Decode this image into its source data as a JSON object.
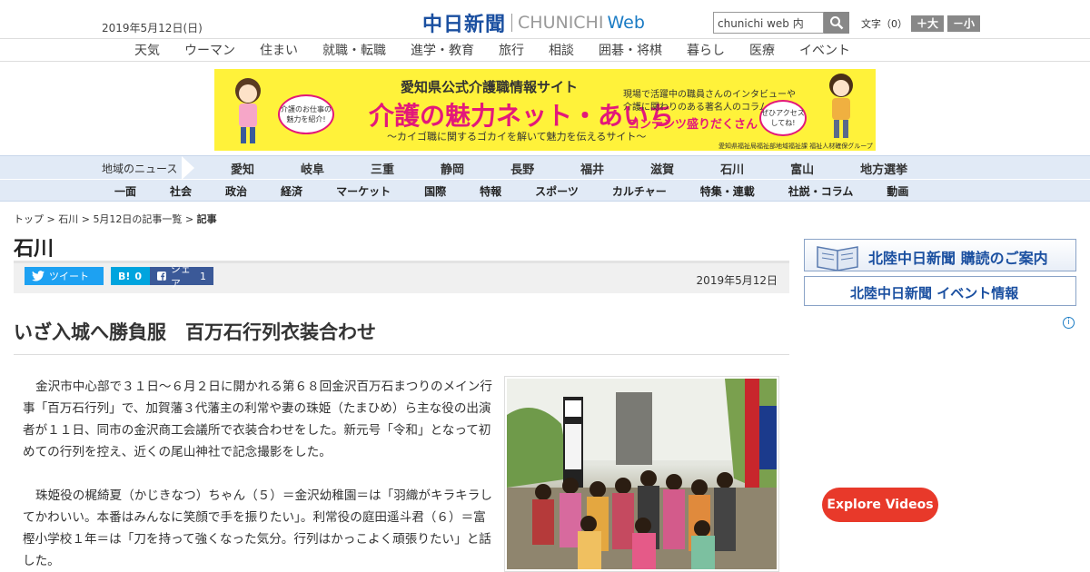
{
  "header": {
    "date": "2019年5月12日(日)",
    "logo_jp": "中日新聞",
    "logo_en1": "CHUNICHI",
    "logo_en2": "Web",
    "search_value": "chunichi web 内",
    "fontsize_label": "文字（0）",
    "fontsize_up": "＋大",
    "fontsize_down": "－小"
  },
  "category_nav": [
    "天気",
    "ウーマン",
    "住まい",
    "就職・転職",
    "進学・教育",
    "旅行",
    "相談",
    "囲碁・将棋",
    "暮らし",
    "医療",
    "イベント"
  ],
  "banner": {
    "t1": "愛知県公式介護職情報サイト",
    "t2": "介護の魅力ネット・あいち",
    "t3": "〜カイゴ職に関するゴカイを解いて魅力を伝えるサイト〜",
    "t4a": "現場で活躍中の職員さんのインタビューや",
    "t4b": "介護に関わりのある著名人のコラムなど",
    "t5": "コンテンツ盛りだくさん",
    "t6": "愛知県福祉局福祉部地域福祉課 福祉人材確保グループ",
    "bubble1": "介護のお仕事の魅力を紹介!",
    "bubble2": "ぜひアクセスしてね!"
  },
  "region_nav": {
    "label": "地域のニュース",
    "items": [
      "愛知",
      "岐阜",
      "三重",
      "静岡",
      "長野",
      "福井",
      "滋賀",
      "石川",
      "富山",
      "地方選挙"
    ]
  },
  "section_nav": [
    "一面",
    "社会",
    "政治",
    "経済",
    "マーケット",
    "国際",
    "特報",
    "スポーツ",
    "カルチャー",
    "特集・連載",
    "社説・コラム",
    "動画"
  ],
  "breadcrumb": {
    "top": "トップ",
    "pref": "石川",
    "list": "5月12日の記事一覧",
    "current": "記事",
    "sep": ">"
  },
  "article": {
    "pref_title": "石川",
    "tweet_label": "ツイート",
    "hatena_label": "B!",
    "hatena_count": "0",
    "fb_label": "シェア",
    "fb_count": "1",
    "date": "2019年5月12日",
    "headline": "いざ入城へ勝負服　百万石行列衣装合わせ",
    "paragraphs": [
      "金沢市中心部で３１日～６月２日に開かれる第６８回金沢百万石まつりのメイン行事「百万石行列」で、加賀藩３代藩主の利常や妻の珠姫（たまひめ）ら主な役の出演者が１１日、同市の金沢商工会議所で衣装合わせをした。新元号「令和」となって初めての行列を控え、近くの尾山神社で記念撮影をした。",
      "珠姫役の梶綺夏（かじきなつ）ちゃん（５）＝金沢幼稚園＝は「羽織がキラキラしてかわいい。本番はみんなに笑顔で手を振りたい」。利常役の庭田遥斗君（６）＝富樫小学校１年＝は「刀を持って強くなった気分。行列はかっこよく頑張りたい」と話した。"
    ]
  },
  "sidebar": {
    "ad1": "北陸中日新聞 購読のご案内",
    "ad2": "北陸中日新聞 イベント情報",
    "adinfo": "i",
    "explore": "Explore Videos"
  }
}
